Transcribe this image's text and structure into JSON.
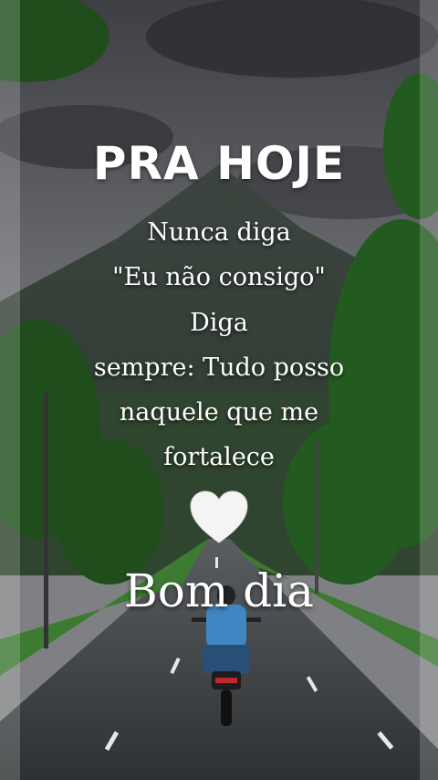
{
  "header": {
    "title": "PRA HOJE"
  },
  "message": {
    "lines": [
      "Nunca diga",
      "\"Eu não consigo\"",
      "Diga",
      "sempre: Tudo posso",
      "naquele que me",
      "fortalece"
    ]
  },
  "heart_icon": "white-heart-icon",
  "greeting": "Bom dia",
  "colors": {
    "text": "#ffffff",
    "sky": "#5b5e63",
    "road": "#3a3d40",
    "foliage": "#2f6b2a",
    "rider_shirt": "#3f86c2"
  }
}
